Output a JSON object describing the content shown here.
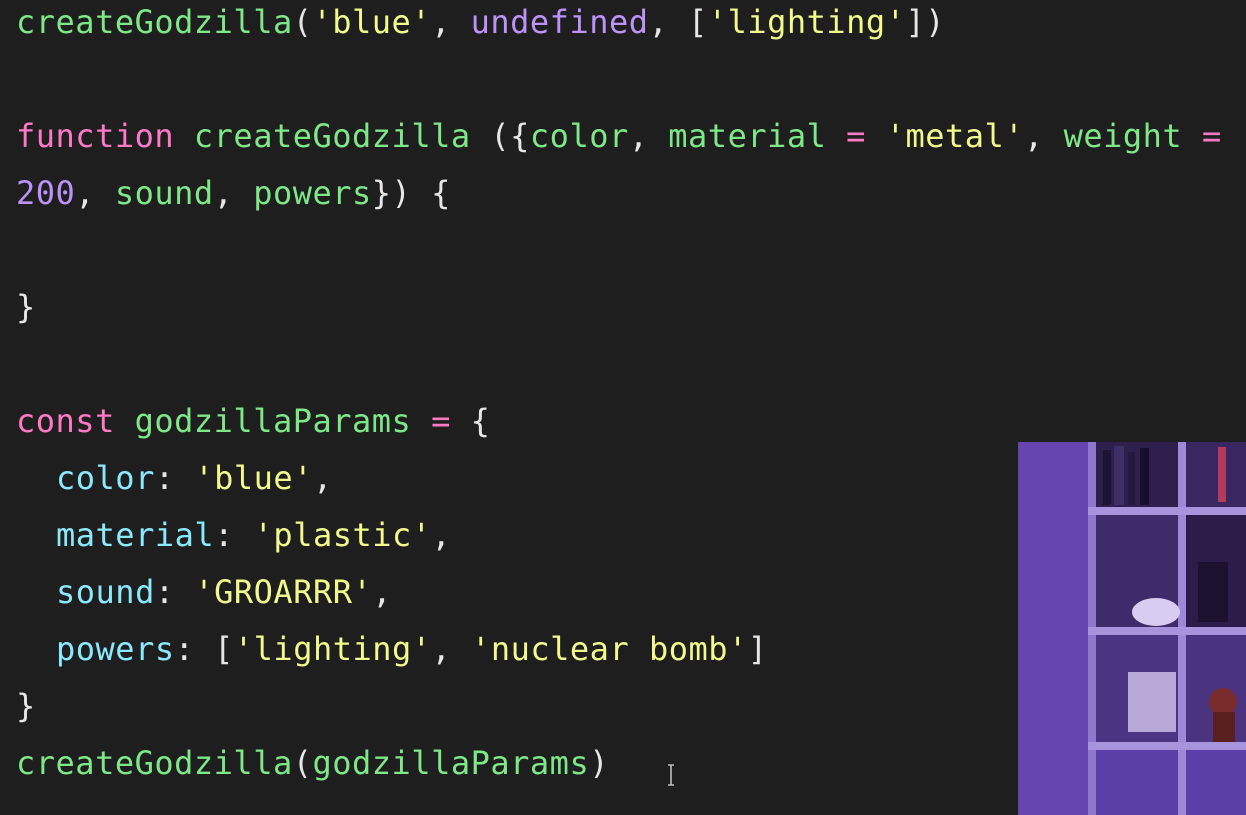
{
  "code": {
    "line1": {
      "fn": "createGodzilla",
      "open": "(",
      "s1": "'blue'",
      "c1": ", ",
      "undef": "undefined",
      "c2": ", [",
      "s2": "'lighting'",
      "close": "])"
    },
    "line3": {
      "kw": "function",
      "sp": " ",
      "fn": "createGodzilla",
      "open": " ({",
      "p1": "color",
      "c1": ", ",
      "p2": "material",
      "eq1": " = ",
      "s1": "'metal'",
      "c2": ", ",
      "p3": "weight",
      "eq2": " ="
    },
    "line4": {
      "num": "200",
      "c1": ", ",
      "p1": "sound",
      "c2": ", ",
      "p2": "powers",
      "close": "}) {"
    },
    "line6": {
      "brace": "}"
    },
    "line8": {
      "kw": "const",
      "sp": " ",
      "name": "godzillaParams",
      "eq": " = ",
      "brace": "{"
    },
    "line9": {
      "key": "color",
      "colon": ": ",
      "val": "'blue'",
      "comma": ","
    },
    "line10": {
      "key": "material",
      "colon": ": ",
      "val": "'plastic'",
      "comma": ","
    },
    "line11": {
      "key": "sound",
      "colon": ": ",
      "val": "'GROARRR'",
      "comma": ","
    },
    "line12": {
      "key": "powers",
      "colon": ": [",
      "v1": "'lighting'",
      "comma": ", ",
      "v2": "'nuclear bomb'",
      "close": "]"
    },
    "line13": {
      "brace": "}"
    },
    "line14": {
      "fn": "createGodzilla",
      "open": "(",
      "arg": "godzillaParams",
      "close": ")"
    }
  },
  "colors": {
    "background": "#1e1e1e",
    "function": "#7ee787",
    "keyword": "#ff79c6",
    "string": "#f1fa8c",
    "number": "#bd93f9",
    "property": "#8be9fd"
  },
  "icons": {
    "cursor": "text-cursor-icon"
  }
}
